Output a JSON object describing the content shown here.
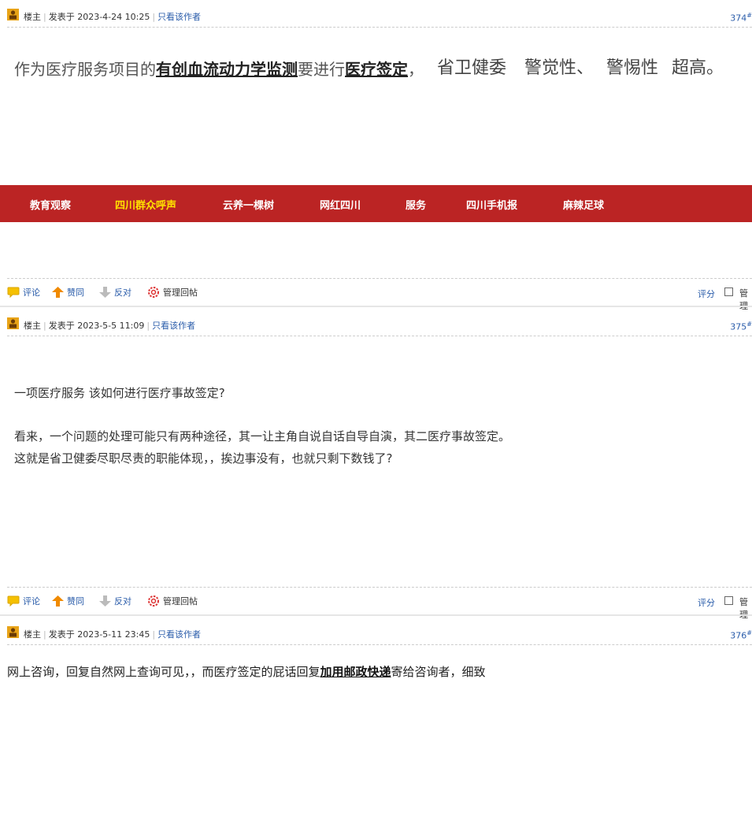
{
  "posts": [
    {
      "author": "楼主",
      "posted_prefix": "发表于",
      "timestamp": "2023-4-24 10:25",
      "only_author": "只看该作者",
      "floor": "374",
      "floor_mark": "#",
      "content": {
        "seg1": "作为医疗服务项目的",
        "bold1": "有创血流动力学监测",
        "seg2": "要进行",
        "bold2": "医疗签定",
        "seg3": "，",
        "seg4": "省卫健委",
        "seg5": "警觉性、",
        "seg6": "警惕性",
        "seg7": "超高。"
      }
    },
    {
      "author": "楼主",
      "posted_prefix": "发表于",
      "timestamp": "2023-5-5 11:09",
      "only_author": "只看该作者",
      "floor": "375",
      "floor_mark": "#",
      "content": {
        "line1": "一项医疗服务  该如何进行医疗事故签定?",
        "line2": "看来，一个问题的处理可能只有两种途径，其一让主角自说自话自导自演，其二医疗事故签定。",
        "line3": "这就是省卫健委尽职尽责的职能体现，，挨边事没有，也就只剩下数钱了?"
      }
    },
    {
      "author": "楼主",
      "posted_prefix": "发表于",
      "timestamp": "2023-5-11 23:45",
      "only_author": "只看该作者",
      "floor": "376",
      "floor_mark": "#",
      "content": {
        "seg1": "网上咨询，回复自然网上查询可见，，而医疗签定的屁话回复",
        "bold1": "加用邮政快递",
        "seg2": "寄给咨询者，细致"
      }
    }
  ],
  "nav": {
    "items": [
      "教育观察",
      "四川群众呼声",
      "云养一棵树",
      "网红四川",
      "服务",
      "四川手机报",
      "麻辣足球"
    ],
    "active_index": 1
  },
  "actions": {
    "comment": "评论",
    "like": "赞同",
    "oppose": "反对",
    "manage": "管理回帖",
    "rate": "评分",
    "manage_short": "管理"
  },
  "colors": {
    "nav_bg": "#bb2424",
    "nav_active": "#ffe100",
    "link": "#2a5caa"
  }
}
